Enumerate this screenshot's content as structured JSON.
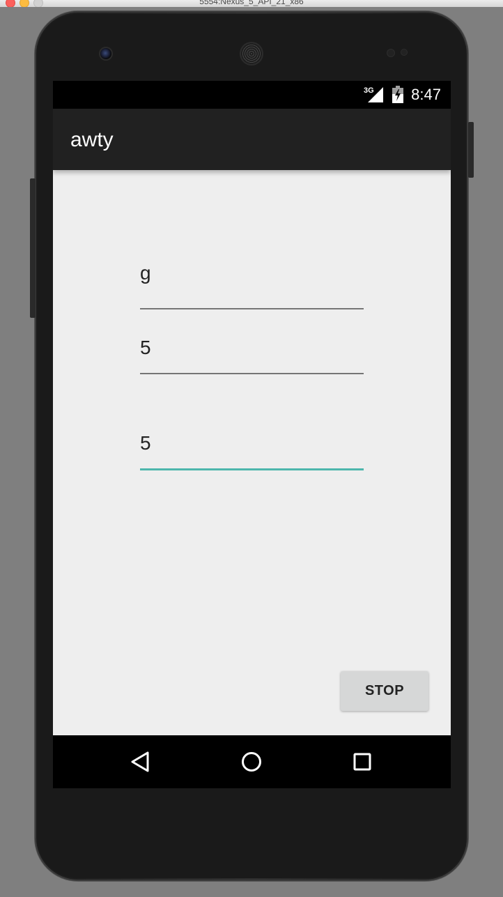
{
  "window": {
    "title": "5554:Nexus_5_API_21_x86"
  },
  "status_bar": {
    "network": "3G",
    "time": "8:47"
  },
  "app_bar": {
    "title": "awty"
  },
  "form": {
    "fields": [
      {
        "value": "g",
        "focused": false
      },
      {
        "value": "5",
        "focused": false
      },
      {
        "value": "5",
        "focused": true
      }
    ],
    "accent_color": "#4db6ac"
  },
  "actions": {
    "stop_label": "STOP"
  },
  "nav_bar": {
    "icons": [
      "back-icon",
      "home-icon",
      "recents-icon"
    ]
  }
}
